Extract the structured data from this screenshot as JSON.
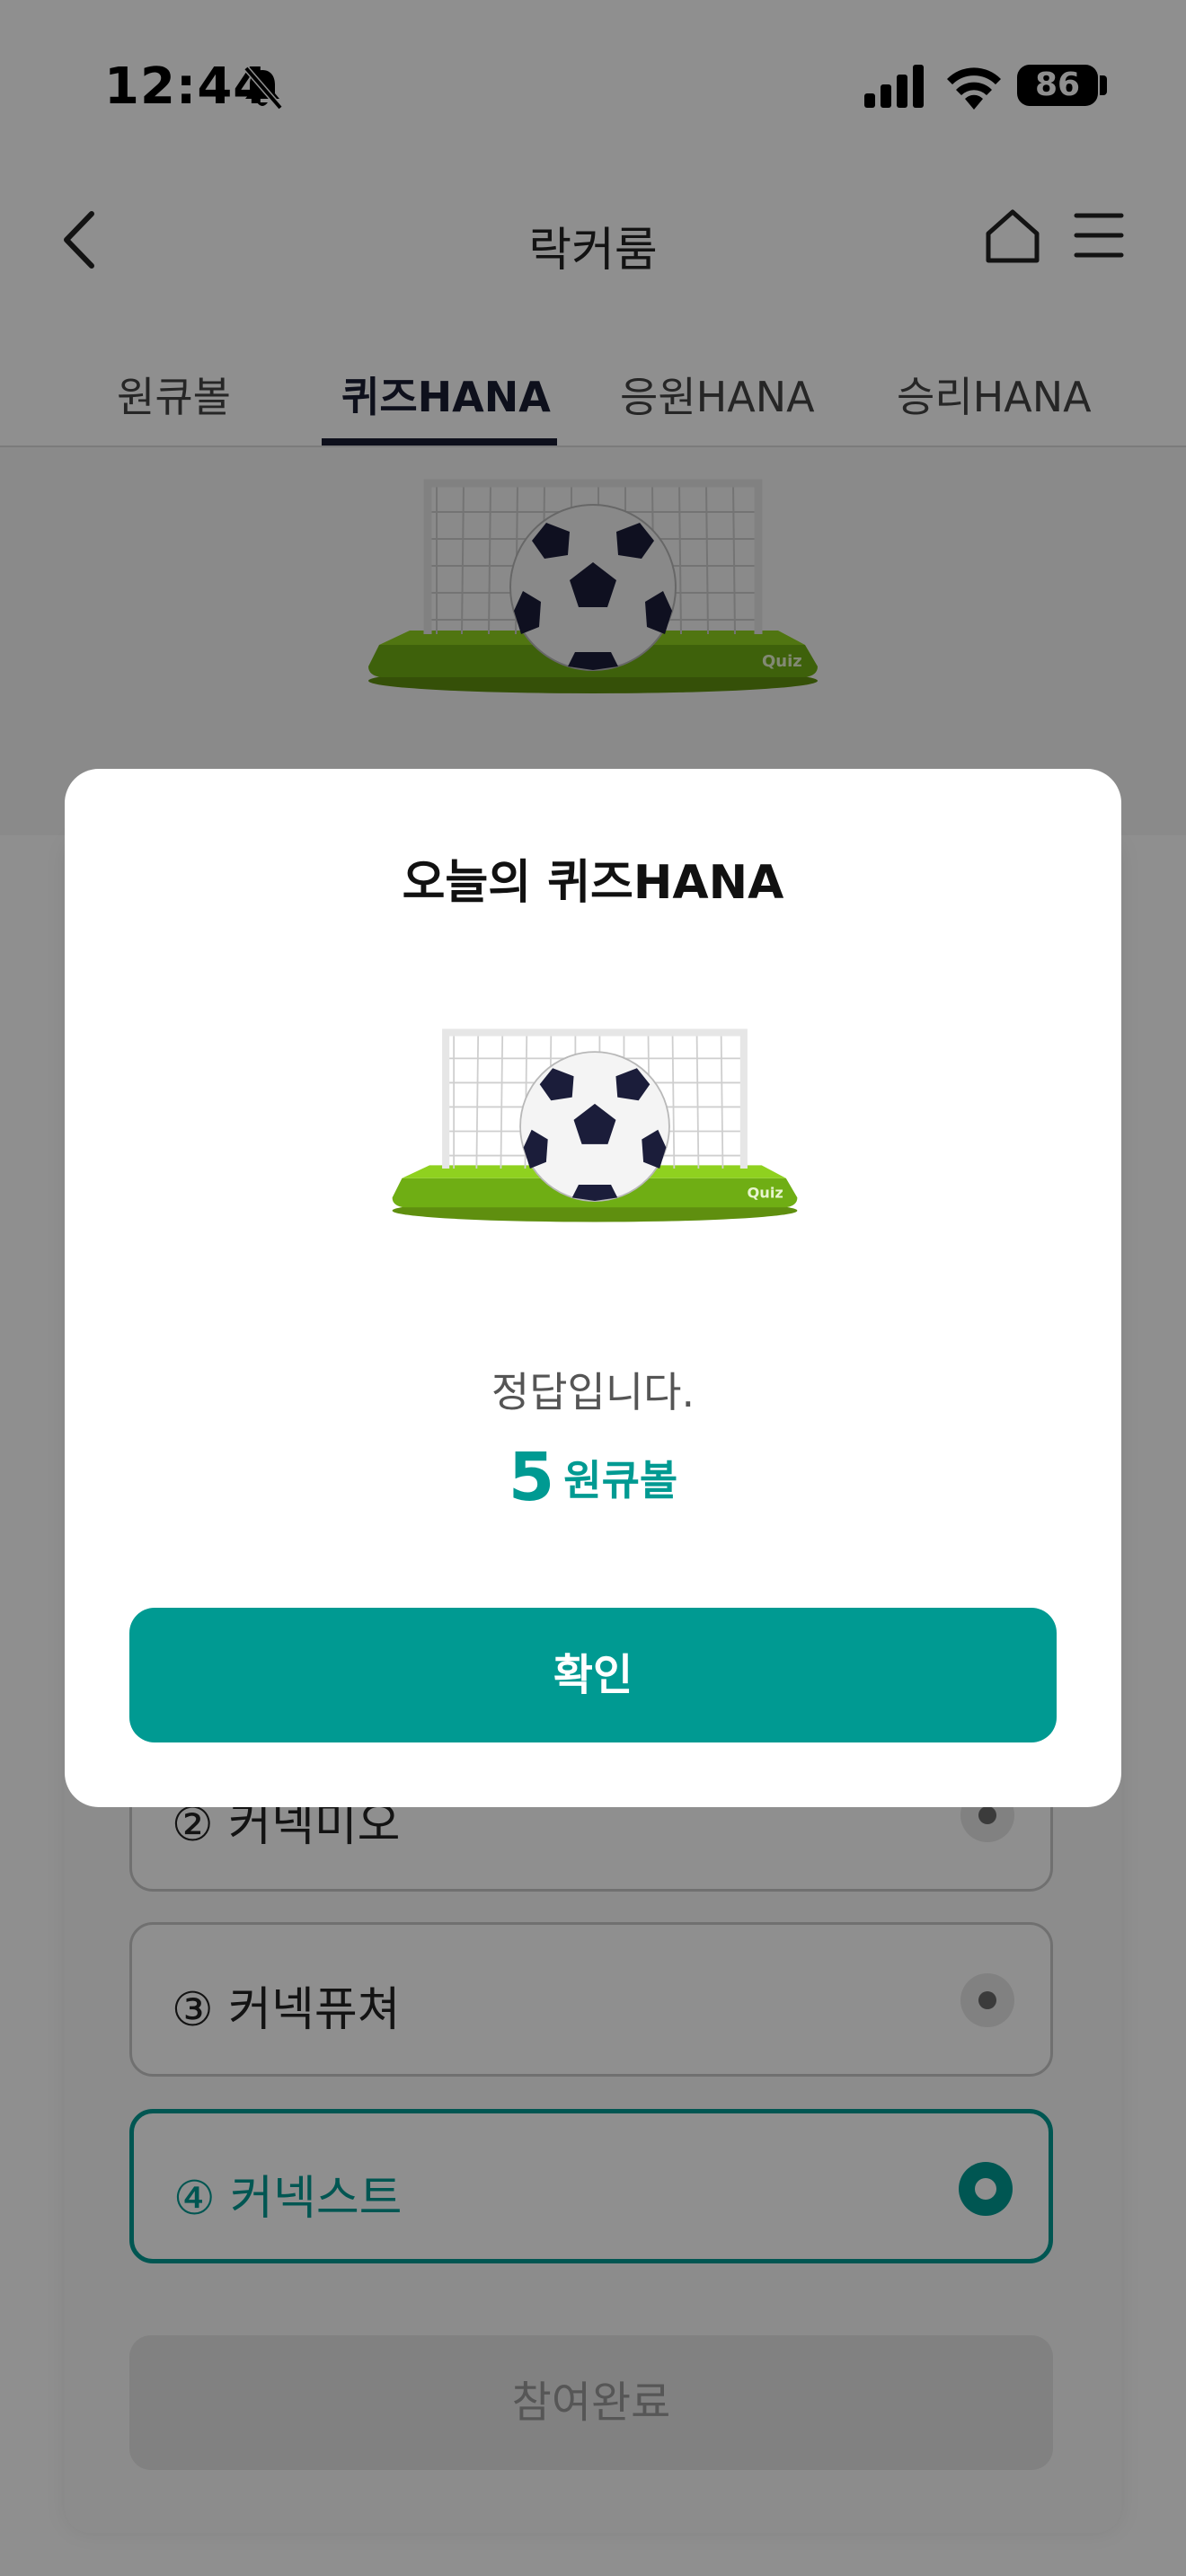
{
  "status_bar": {
    "time": "12:44",
    "battery": "86"
  },
  "nav": {
    "title": "락커룸"
  },
  "tabs": [
    {
      "label": "원큐볼"
    },
    {
      "label": "퀴즈HANA"
    },
    {
      "label": "응원HANA"
    },
    {
      "label": "승리HANA"
    }
  ],
  "active_tab": "퀴즈HANA",
  "quiz": {
    "options": [
      {
        "label": "② 커넥미오",
        "selected": false
      },
      {
        "label": "③ 커넥퓨쳐",
        "selected": false
      },
      {
        "label": "④ 커넥스트",
        "selected": true
      }
    ],
    "submit_label": "참여완료",
    "image_badge": "Quiz"
  },
  "modal": {
    "title": "오늘의 퀴즈HANA",
    "result": "정답입니다.",
    "reward_amount": "5",
    "reward_unit": "원큐볼",
    "confirm_label": "확인",
    "image_badge": "Quiz"
  },
  "colors": {
    "accent": "#009a92",
    "tab_active": "#1a1d33",
    "overlay": "rgba(0,0,0,0.44)"
  },
  "icons": [
    "bell-slash-icon",
    "signal-icon",
    "wifi-icon",
    "battery-icon",
    "back-icon",
    "home-icon",
    "menu-icon",
    "radio-icon"
  ]
}
